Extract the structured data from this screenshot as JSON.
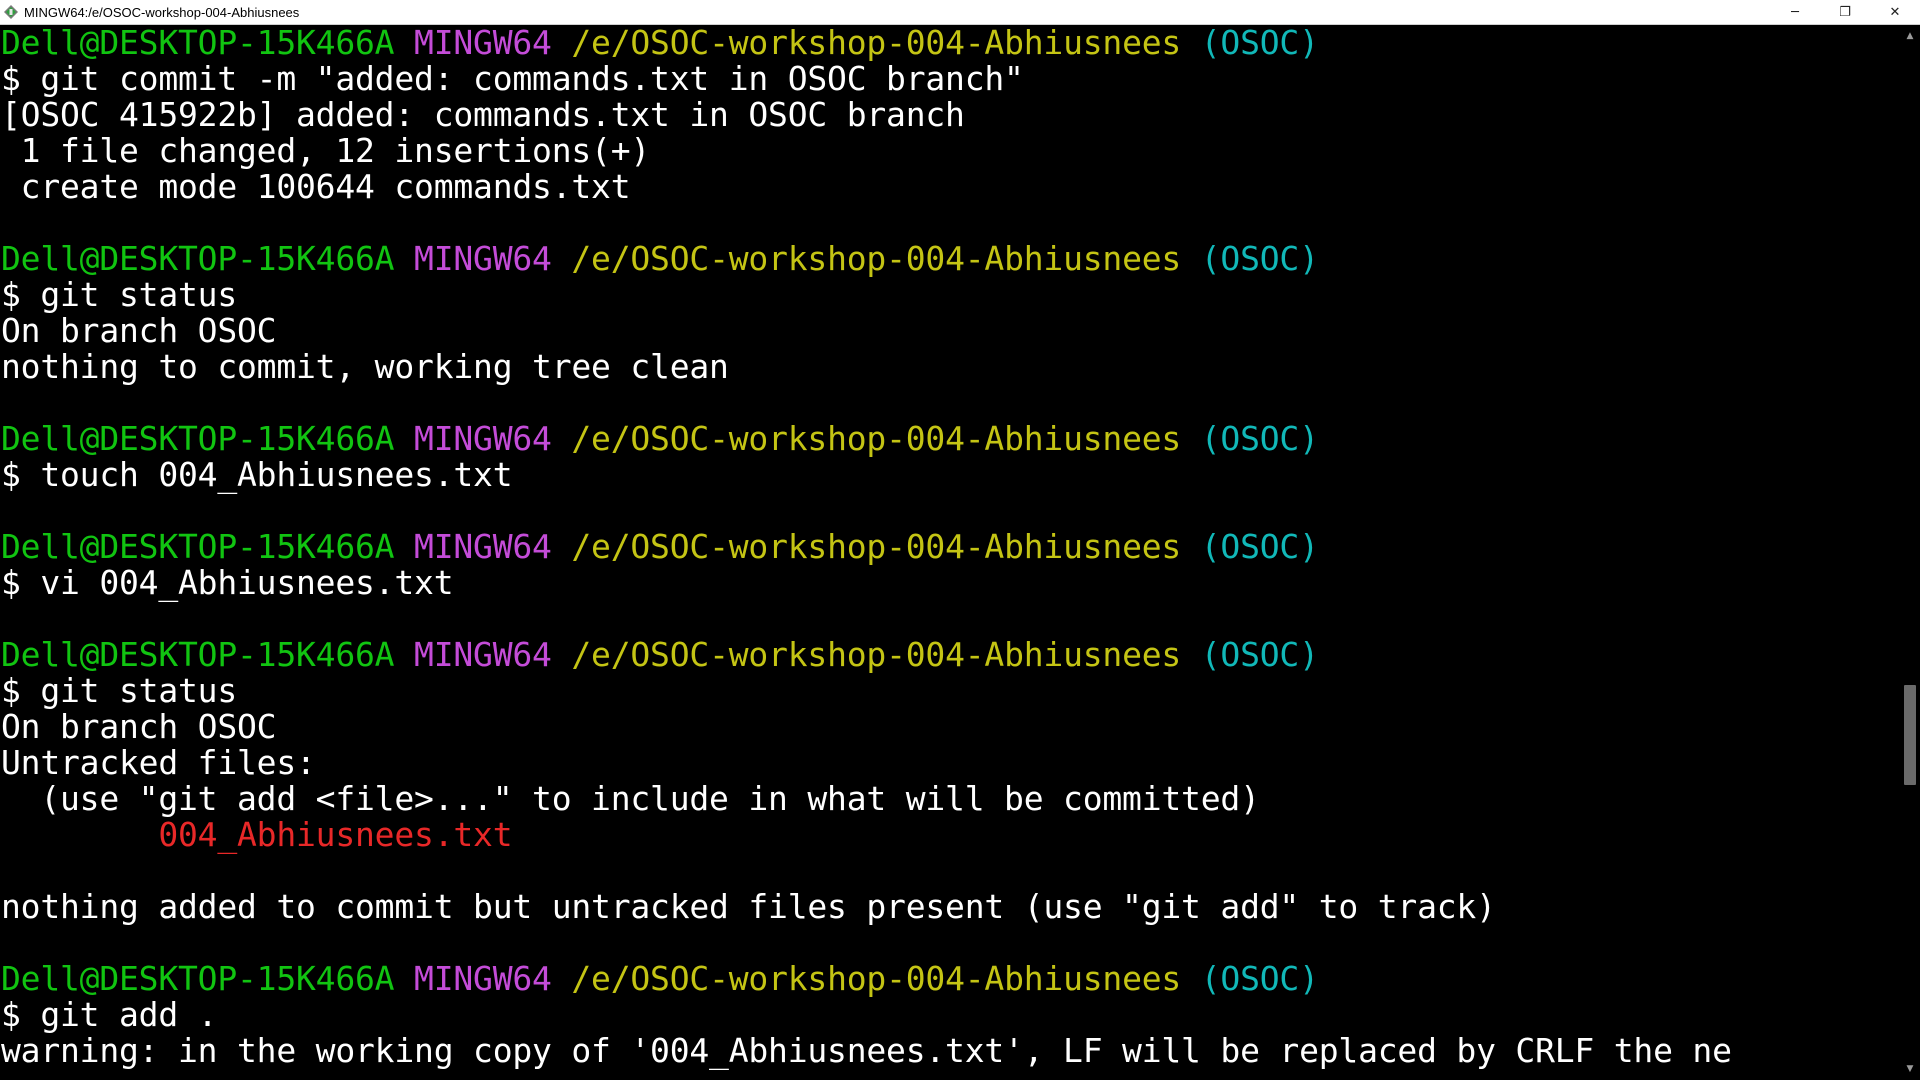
{
  "window": {
    "title": "MINGW64:/e/OSOC-workshop-004-Abhiusnees",
    "controls": {
      "minimize": "─",
      "maximize": "❐",
      "close": "✕"
    }
  },
  "colors": {
    "user_host": "#11c411",
    "system": "#c44cd8",
    "path": "#c4c414",
    "branch": "#11b8b8",
    "untracked": "#e82828",
    "text": "#ffffff",
    "background": "#000000"
  },
  "prompt": {
    "user_host": "Dell@DESKTOP-15K466A",
    "system": "MINGW64",
    "path": "/e/OSOC-workshop-004-Abhiusnees",
    "branch": "(OSOC)"
  },
  "terminal": {
    "block1": {
      "command": "$ git commit -m \"added: commands.txt in OSOC branch\"",
      "out1": "[OSOC 415922b] added: commands.txt in OSOC branch",
      "out2": " 1 file changed, 12 insertions(+)",
      "out3": " create mode 100644 commands.txt"
    },
    "block2": {
      "command": "$ git status",
      "out1": "On branch OSOC",
      "out2": "nothing to commit, working tree clean"
    },
    "block3": {
      "command": "$ touch 004_Abhiusnees.txt"
    },
    "block4": {
      "command": "$ vi 004_Abhiusnees.txt"
    },
    "block5": {
      "command": "$ git status",
      "out1": "On branch OSOC",
      "out2": "Untracked files:",
      "out3": "  (use \"git add <file>...\" to include in what will be committed)",
      "untracked_file": "        004_Abhiusnees.txt",
      "out4": "nothing added to commit but untracked files present (use \"git add\" to track)"
    },
    "block6": {
      "command": "$ git add .",
      "warning": "warning: in the working copy of '004_Abhiusnees.txt', LF will be replaced by CRLF the ne"
    }
  }
}
